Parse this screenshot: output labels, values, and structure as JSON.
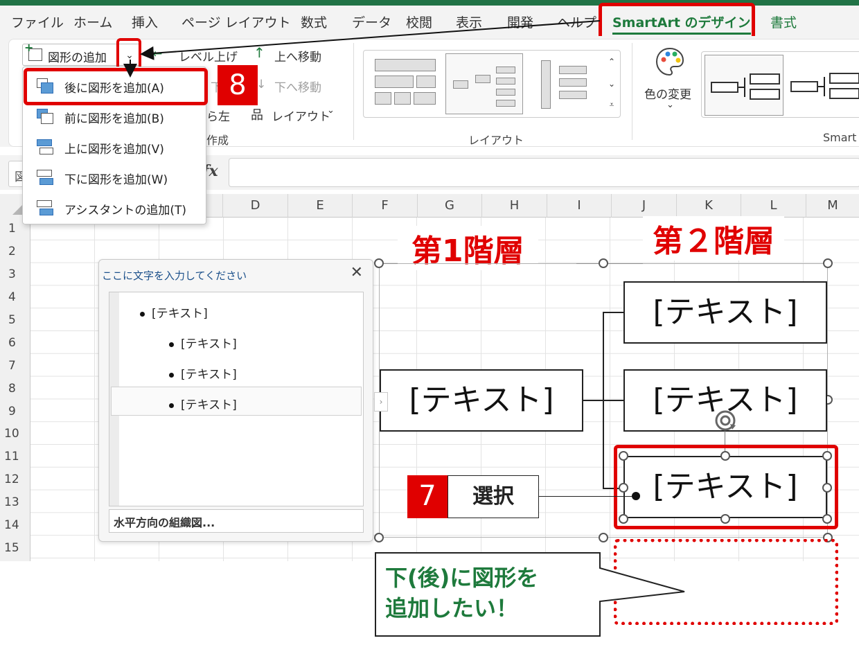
{
  "menu": {
    "tabs": [
      "ファイル",
      "ホーム",
      "挿入",
      "ページ レイアウト",
      "数式",
      "データ",
      "校閲",
      "表示",
      "開発",
      "ヘルプ",
      "SmartArt のデザイン",
      "書式"
    ],
    "active_tab": "SmartArt のデザイン"
  },
  "ribbon": {
    "add_shape": "図形の追加",
    "level_up": "レベル上げ",
    "move_up": "上へ移動",
    "move_down": "下へ移動",
    "level_down_partial": "下",
    "rtl_partial": "ら左",
    "layout_btn": "レイアウト",
    "create_group_partial": "作成",
    "layout_group": "レイアウト",
    "color_change": "色の変更",
    "smartart_styles_partial": "Smart"
  },
  "dropdown": {
    "items": [
      {
        "label": "後に図形を追加(A)"
      },
      {
        "label": "前に図形を追加(B)"
      },
      {
        "label": "上に図形を追加(V)"
      },
      {
        "label": "下に図形を追加(W)"
      },
      {
        "label": "アシスタントの追加(T)"
      }
    ]
  },
  "formula_bar": {
    "name_box_partial": "図",
    "fx": "fx"
  },
  "columns": [
    "D",
    "E",
    "F",
    "G",
    "H",
    "I",
    "J",
    "K",
    "L",
    "M"
  ],
  "rows": [
    "1",
    "2",
    "3",
    "4",
    "5",
    "6",
    "7",
    "8",
    "9",
    "10",
    "11",
    "12",
    "13",
    "14",
    "15"
  ],
  "text_pane": {
    "title": "ここに文字を入力してください",
    "items": [
      "[テキスト]",
      "[テキスト]",
      "[テキスト]",
      "[テキスト]"
    ],
    "footer": "水平方向の組織図..."
  },
  "smartart": {
    "root_text": "[テキスト]",
    "child_texts": [
      "[テキスト]",
      "[テキスト]",
      "[テキスト]"
    ]
  },
  "annotations": {
    "level1": "第1階層",
    "level2": "第２階層",
    "step7_num": "7",
    "step7_label": "選択",
    "step8_num": "8",
    "callout": [
      "下(後)に図形を",
      "追加したい！"
    ]
  },
  "colors": {
    "accent_green": "#1e7a3c",
    "annotation_red": "#e00000",
    "excel_green": "#217346"
  }
}
